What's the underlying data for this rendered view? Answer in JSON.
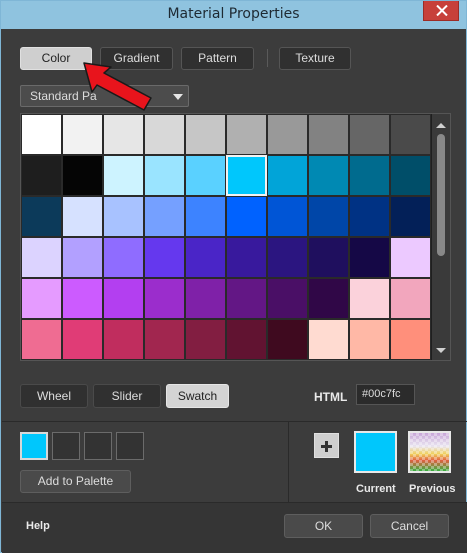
{
  "window": {
    "title": "Material Properties"
  },
  "tabs": [
    {
      "label": "Color",
      "active": true
    },
    {
      "label": "Gradient",
      "active": false
    },
    {
      "label": "Pattern",
      "active": false
    },
    {
      "label": "Texture",
      "active": false
    }
  ],
  "palette_dropdown": {
    "selected": "Standard Pa"
  },
  "swatches": [
    [
      "#ffffff",
      "#f2f2f2",
      "#e6e6e6",
      "#d8d8d8",
      "#c6c6c6",
      "#b0b0b0",
      "#999999",
      "#828282",
      "#666666",
      "#4a4a4a"
    ],
    [
      "#1e1e1e",
      "#050505",
      "#cdf3ff",
      "#9ae4ff",
      "#5ad1ff",
      "#00c7fc",
      "#01a4d8",
      "#0089b3",
      "#006b8e",
      "#004e69"
    ],
    [
      "#0c3a5a",
      "#d6e1ff",
      "#a8c2ff",
      "#75a0ff",
      "#3d83ff",
      "#0062ff",
      "#0055d6",
      "#0046a8",
      "#003284",
      "#032058"
    ],
    [
      "#dcd3ff",
      "#b2a0ff",
      "#8f6cff",
      "#6538ee",
      "#4a25c7",
      "#38199d",
      "#2b1580",
      "#1f0f5e",
      "#150846",
      "#ecc9ff"
    ],
    [
      "#e59bff",
      "#cc5bff",
      "#b33ff0",
      "#9b2dcc",
      "#7f21a8",
      "#631785",
      "#4a0f66",
      "#300747",
      "#fbd2db",
      "#f2a6bd"
    ],
    [
      "#ef6c92",
      "#e03c76",
      "#c02d5e",
      "#a1264f",
      "#821e41",
      "#611331",
      "#3f0a1f",
      "#ffdbd1",
      "#ffb8a6",
      "#ff8f7b"
    ]
  ],
  "selected_swatch": {
    "row": 1,
    "col": 5
  },
  "view_modes": [
    {
      "label": "Wheel",
      "active": false
    },
    {
      "label": "Slider",
      "active": false
    },
    {
      "label": "Swatch",
      "active": true
    }
  ],
  "html_field": {
    "label": "HTML",
    "value": "#00c7fc"
  },
  "custom_palette": {
    "add_label": "Add to Palette",
    "slots": [
      "#00c7fc",
      null,
      null,
      null
    ]
  },
  "current": {
    "label": "Current",
    "color": "#00c7fc"
  },
  "previous": {
    "label": "Previous"
  },
  "footer": {
    "help": "Help",
    "ok": "OK",
    "cancel": "Cancel"
  },
  "colors": {
    "titlebar": "#8fc3df",
    "close": "#c7403a",
    "arrow": "#e8141c",
    "panel": "#3c3c3c"
  }
}
